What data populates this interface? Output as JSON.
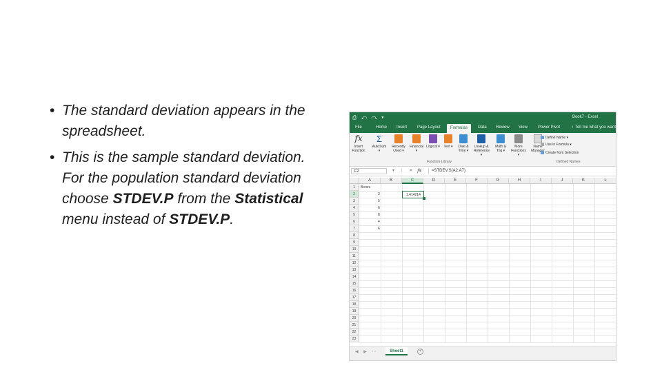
{
  "slide": {
    "bullets": [
      {
        "text": "The standard deviation appears in the spreadsheet."
      },
      {
        "pre": "This is the sample standard deviation. For the population standard deviation choose ",
        "bold1": "STDEV.P",
        "mid": " from the ",
        "bold2": "Statistical",
        "post": " menu instead of ",
        "bold3": "STDEV.P",
        "end": "."
      }
    ],
    "bullet_char": "•"
  },
  "excel": {
    "quick_access": "⎙ ↶ ↷ ▾",
    "window_title": "Book7 - Excel",
    "tabs": [
      "File",
      "Home",
      "Insert",
      "Page Layout",
      "Formulas",
      "Data",
      "Review",
      "View",
      "Power Pivot"
    ],
    "active_tab": "Formulas",
    "tell_me": "Tell me what you want",
    "ribbon": {
      "buttons": [
        {
          "label": "Insert Function",
          "icon": "fx-icon"
        },
        {
          "label": "AutoSum ▾",
          "icon": "sigma-icon"
        },
        {
          "label": "Recently Used ▾",
          "icon": "star-book-icon"
        },
        {
          "label": "Financial ▾",
          "icon": "book-icon"
        },
        {
          "label": "Logical ▾",
          "icon": "question-book-icon"
        },
        {
          "label": "Text ▾",
          "icon": "text-book-icon"
        },
        {
          "label": "Date & Time ▾",
          "icon": "calendar-book-icon"
        },
        {
          "label": "Lookup & Reference ▾",
          "icon": "lookup-book-icon"
        },
        {
          "label": "Math & Trig ▾",
          "icon": "theta-book-icon"
        },
        {
          "label": "More Functions ▾",
          "icon": "more-book-icon"
        },
        {
          "label": "Name Manager",
          "icon": "name-manager-icon"
        }
      ],
      "group_function_library": "Function Library",
      "group_defined_names": "Defined Names",
      "define_name": "Define Name ▾",
      "use_in_formula": "Use in Formula ▾",
      "create_from_selection": "Create from Selection",
      "colors": {
        "brand": "#217346",
        "icon_blue": "#1f5fa8",
        "icon_orange": "#e8822a",
        "icon_purple": "#7a4fb0",
        "icon_gray": "#8a8a8a"
      }
    },
    "name_box": "C2",
    "formula_bar_buttons": "▾ ⋮ ✕ ✓",
    "fx_label": "fx",
    "formula": "=STDEV.S(A2:A7)",
    "columns": [
      "A",
      "B",
      "C",
      "D",
      "E",
      "F",
      "G",
      "H",
      "I",
      "J",
      "K",
      "L"
    ],
    "rows": [
      "1",
      "2",
      "3",
      "4",
      "5",
      "6",
      "7",
      "8",
      "9",
      "10",
      "11",
      "12",
      "13",
      "14",
      "15",
      "16",
      "17",
      "18",
      "19",
      "20",
      "21",
      "22",
      "23"
    ],
    "cells": {
      "A1": "Bones",
      "A2": "2",
      "A3": "5",
      "A4": "6",
      "A5": "8",
      "A6": "4",
      "A7": "6",
      "C2": "1.414214"
    },
    "sheet_tab": "Sheet1",
    "add_sheet": "+",
    "sheet_arrows": "◀ ▶ ⋯"
  }
}
